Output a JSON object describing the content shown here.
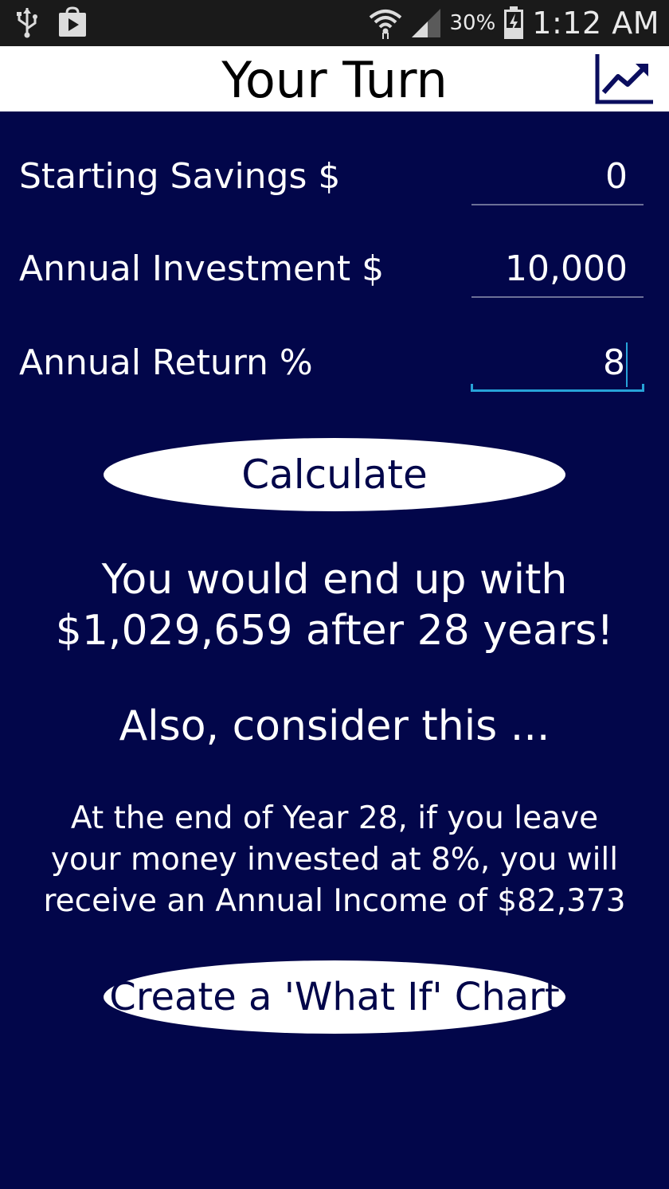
{
  "status_bar": {
    "battery_percent": "30%",
    "time": "1:12 AM",
    "icons": [
      "usb-icon",
      "play-store-icon",
      "wifi-icon",
      "signal-icon",
      "battery-icon"
    ]
  },
  "title_bar": {
    "title": "Your Turn",
    "chart_icon": "trending-chart-icon"
  },
  "form": {
    "starting_savings": {
      "label": "Starting Savings $",
      "value": "0"
    },
    "annual_investment": {
      "label": "Annual Investment $",
      "value": "10,000"
    },
    "annual_return": {
      "label": "Annual Return %",
      "value": "8"
    }
  },
  "calculate_label": "Calculate",
  "result": {
    "line1": "You would end up with",
    "line2": "$1,029,659 after 28 years!",
    "consider": "Also, consider this ...",
    "income_line1": "At the end of Year 28, if you leave",
    "income_line2": "your money invested at 8%, you will",
    "income_line3": "receive an Annual Income of $82,373"
  },
  "what_if_label": "Create a 'What If' Chart",
  "colors": {
    "background": "#02064a",
    "status_bar": "#1a1a1a",
    "accent": "#27a3d8",
    "button_bg": "#ffffff"
  }
}
